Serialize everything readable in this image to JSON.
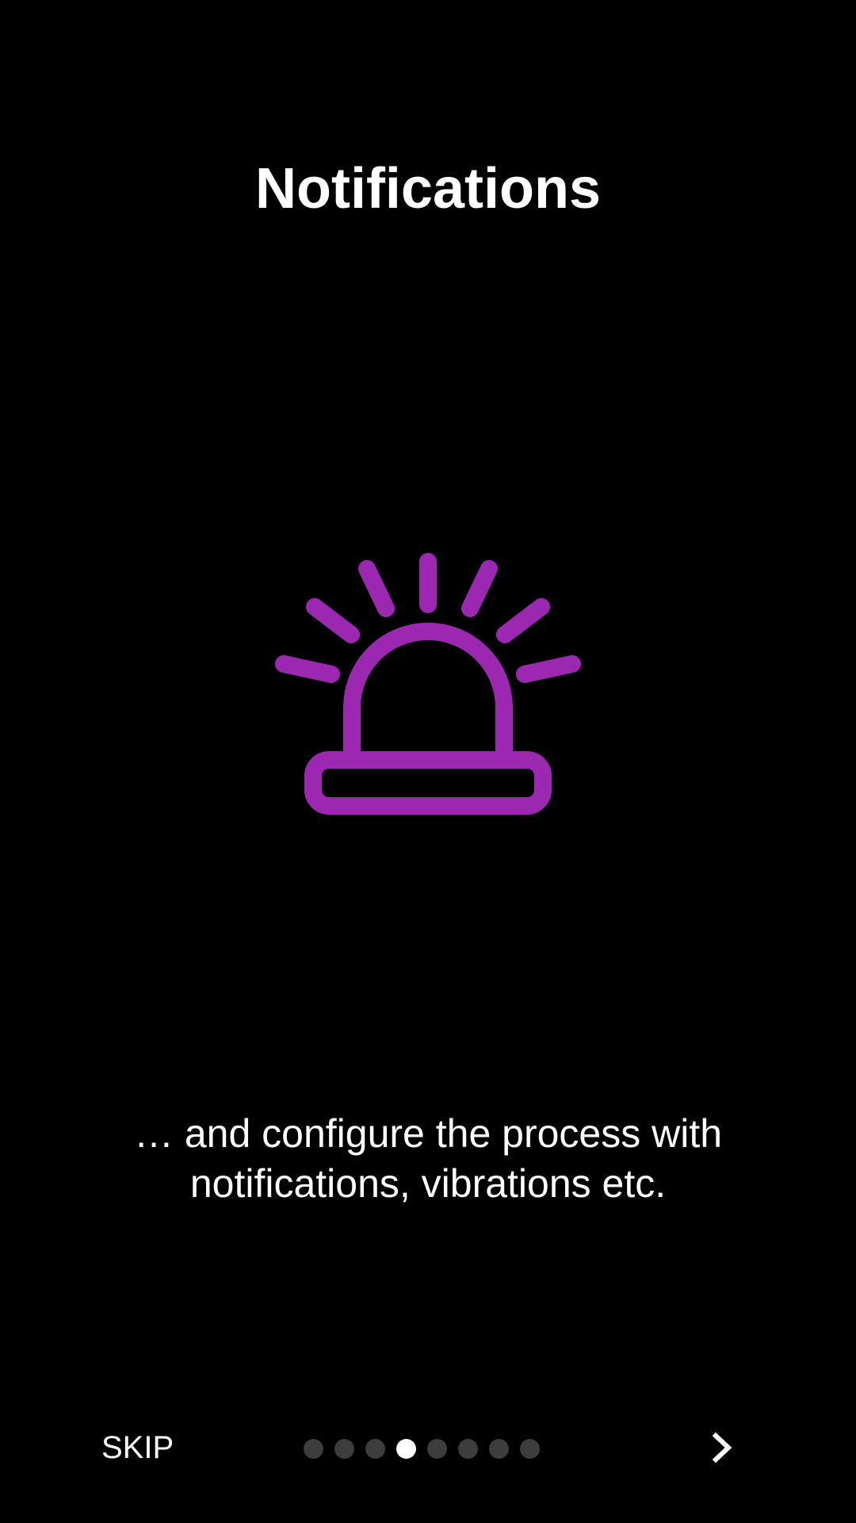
{
  "screen": {
    "title": "Notifications",
    "description": "… and configure the process with notifications, vibrations etc.",
    "illustration": "siren-alarm-icon"
  },
  "navigation": {
    "skip_label": "SKIP",
    "page_count": 8,
    "current_page": 4,
    "next_icon": "chevron-right-icon"
  },
  "colors": {
    "background": "#000000",
    "accent": "#9c27b0",
    "text": "#ffffff",
    "dot_inactive": "#3d3d3d",
    "dot_active": "#ffffff"
  }
}
